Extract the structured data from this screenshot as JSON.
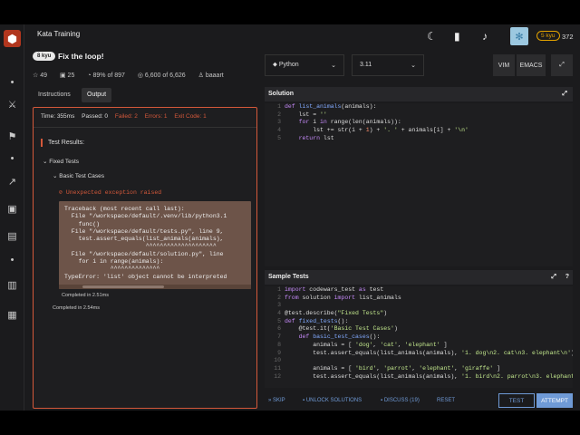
{
  "colors": {
    "accent": "#d4583a",
    "link": "#6f9ad6",
    "rank": "#e2a200"
  },
  "header": {
    "brand": "Kata Training",
    "rank_badge": "5 kyu",
    "honor": "372",
    "icons": [
      "moon-icon",
      "bookmark-icon",
      "bell-icon",
      "avatar"
    ]
  },
  "kata": {
    "kyu": "8 kyu",
    "title": "Fix the loop!",
    "stats": {
      "votes": "49",
      "bookmarks": "25",
      "satisfaction": "89% of 897",
      "completions": "6,600 of 6,626",
      "author": "baaart"
    }
  },
  "tabs": {
    "instructions": "Instructions",
    "output": "Output"
  },
  "output": {
    "time": "Time: 355ms",
    "passed": "Passed: 0",
    "failed": "Failed: 2",
    "errors": "Errors: 1",
    "exit": "Exit Code: 1",
    "results_title": "Test Results:",
    "fixed": "Fixed Tests",
    "basic": "Basic Test Cases",
    "error_msg": "Unexpected exception raised",
    "traceback": [
      "Traceback (most recent call last):",
      "  File \"/workspace/default/.venv/lib/python3.1",
      "    func()",
      "  File \"/workspace/default/tests.py\", line 9,",
      "    test.assert_equals(list_animals(animals),",
      "                       ^^^^^^^^^^^^^^^^^^^^",
      "  File \"/workspace/default/solution.py\", line",
      "    for i in range(animals):",
      "             ^^^^^^^^^^^^^^",
      "TypeError: 'list' object cannot be interpreted"
    ],
    "completed_inner": "Completed in 2.51ms",
    "completed_outer": "Completed in 2.54ms"
  },
  "editor": {
    "language": "Python",
    "version": "3.11",
    "vim": "VIM",
    "emacs": "EMACS",
    "solution_title": "Solution",
    "solution_lines": [
      "1",
      "2",
      "3",
      "4",
      "5"
    ],
    "sample_title": "Sample Tests",
    "sample_lines": [
      "1",
      "2",
      "3",
      "4",
      "5",
      "6",
      "7",
      "8",
      "9",
      "10",
      "11",
      "12"
    ]
  },
  "bottom": {
    "skip": "SKIP",
    "unlock": "UNLOCK SOLUTIONS",
    "discuss": "DISCUSS (19)",
    "reset": "RESET",
    "test": "TEST",
    "attempt": "ATTEMPT"
  }
}
